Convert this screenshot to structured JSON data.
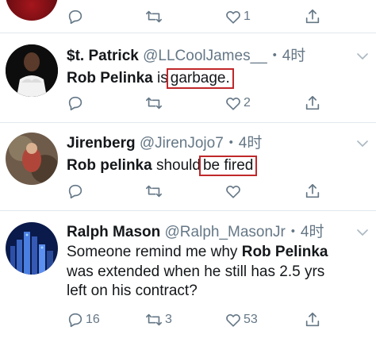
{
  "tweets": [
    {
      "id": "top",
      "actions": {
        "reply": "",
        "retweet": "",
        "like": "1"
      }
    },
    {
      "id": "st-patrick",
      "name": "$t. Patrick",
      "handle": "@LLCoolJames__",
      "time": "・4时",
      "text_parts": [
        "Rob Pelinka",
        " is",
        " garbage."
      ],
      "actions": {
        "reply": "",
        "retweet": "",
        "like": "2"
      }
    },
    {
      "id": "jirenberg",
      "name": "Jirenberg",
      "handle": "@JirenJojo7",
      "time": "・4时",
      "text_parts": [
        "Rob pelinka",
        " should",
        " be fired"
      ],
      "actions": {
        "reply": "",
        "retweet": "",
        "like": ""
      }
    },
    {
      "id": "ralph",
      "name": "Ralph Mason",
      "handle": "@Ralph_MasonJr",
      "time": "・4时",
      "text_parts": [
        "Someone remind me why ",
        "Rob Pelinka",
        "was extended when he still has 2.5 yrs",
        "left on his contract?"
      ],
      "actions": {
        "reply": "16",
        "retweet": "3",
        "like": "53"
      }
    }
  ],
  "colors": {
    "text": "#14171a",
    "muted": "#657786",
    "divider": "#e1e8ed",
    "highlight_box": "#c0282a"
  },
  "icons": [
    "reply-icon",
    "retweet-icon",
    "like-icon",
    "share-icon",
    "chevron-down-icon"
  ]
}
